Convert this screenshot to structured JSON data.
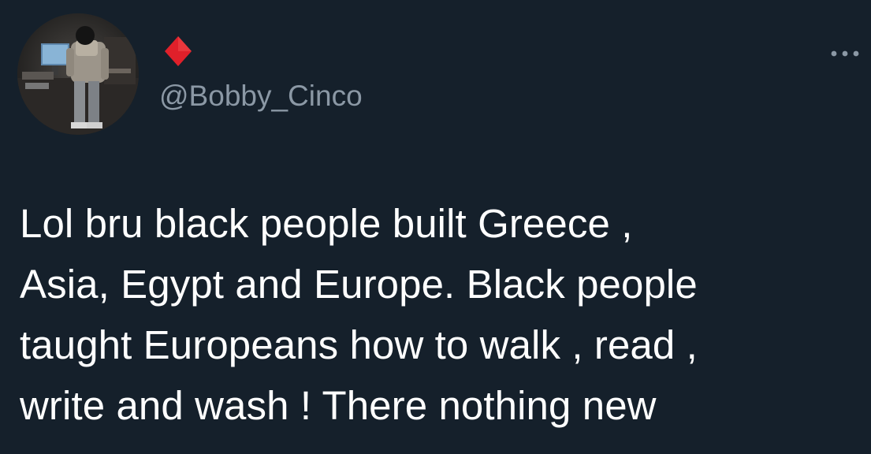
{
  "tweet": {
    "author": {
      "display_name": "",
      "name_icon": "red-diamond-emoji-icon",
      "handle": "@Bobby_Cinco",
      "avatar_description": "avatar-photo"
    },
    "more_icon": "more-options-icon",
    "text": "Lol bru black people built Greece ,\nAsia, Egypt and Europe. Black people\ntaught Europeans how to walk , read ,\nwrite and wash ! There nothing new"
  },
  "colors": {
    "background": "#15202b",
    "text_primary": "#ffffff",
    "text_secondary": "#8b98a5",
    "diamond": "#e0202a"
  }
}
